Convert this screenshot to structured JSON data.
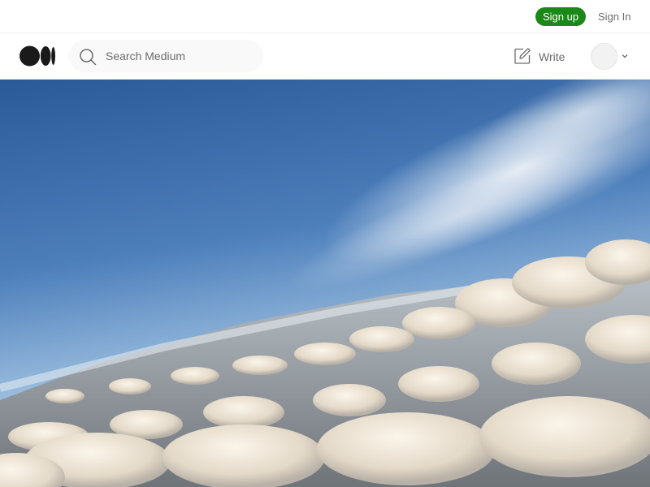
{
  "topbar": {
    "signup_label": "Sign up",
    "signin_label": "Sign In"
  },
  "navbar": {
    "logo_icon": "medium-logo-icon",
    "search": {
      "placeholder": "Search Medium",
      "value": "",
      "icon": "search-icon"
    },
    "write_label": "Write",
    "write_icon": "pencil-square-icon",
    "avatar_icon": "avatar"
  },
  "hero": {
    "subject": "aerial view of sky and clouds"
  },
  "colors": {
    "signup_bg": "#1a8917",
    "text_muted": "#6b6b6b",
    "sky_top": "#2f5f9e",
    "sky_horizon": "#8fb4d8",
    "cloud": "#ece3d4"
  }
}
